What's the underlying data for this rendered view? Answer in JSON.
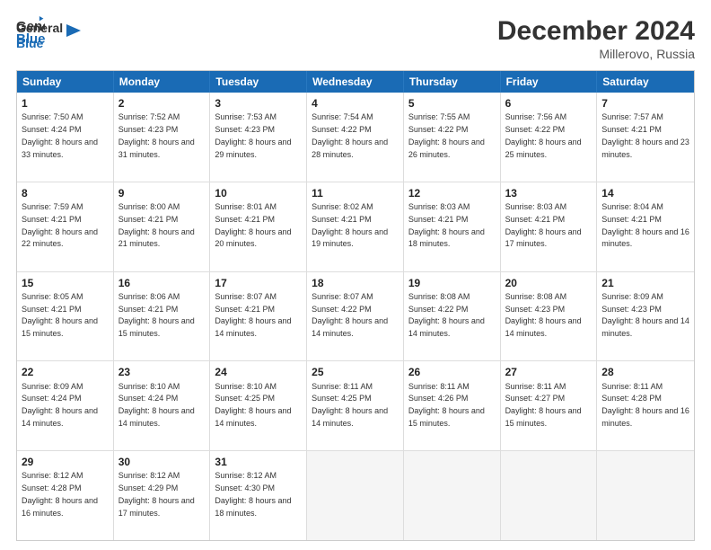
{
  "logo": {
    "line1": "General",
    "line2": "Blue"
  },
  "title": "December 2024",
  "subtitle": "Millerovo, Russia",
  "days": [
    "Sunday",
    "Monday",
    "Tuesday",
    "Wednesday",
    "Thursday",
    "Friday",
    "Saturday"
  ],
  "weeks": [
    [
      {
        "num": "1",
        "sunrise": "7:50 AM",
        "sunset": "4:24 PM",
        "daylight": "8 hours and 33 minutes."
      },
      {
        "num": "2",
        "sunrise": "7:52 AM",
        "sunset": "4:23 PM",
        "daylight": "8 hours and 31 minutes."
      },
      {
        "num": "3",
        "sunrise": "7:53 AM",
        "sunset": "4:23 PM",
        "daylight": "8 hours and 29 minutes."
      },
      {
        "num": "4",
        "sunrise": "7:54 AM",
        "sunset": "4:22 PM",
        "daylight": "8 hours and 28 minutes."
      },
      {
        "num": "5",
        "sunrise": "7:55 AM",
        "sunset": "4:22 PM",
        "daylight": "8 hours and 26 minutes."
      },
      {
        "num": "6",
        "sunrise": "7:56 AM",
        "sunset": "4:22 PM",
        "daylight": "8 hours and 25 minutes."
      },
      {
        "num": "7",
        "sunrise": "7:57 AM",
        "sunset": "4:21 PM",
        "daylight": "8 hours and 23 minutes."
      }
    ],
    [
      {
        "num": "8",
        "sunrise": "7:59 AM",
        "sunset": "4:21 PM",
        "daylight": "8 hours and 22 minutes."
      },
      {
        "num": "9",
        "sunrise": "8:00 AM",
        "sunset": "4:21 PM",
        "daylight": "8 hours and 21 minutes."
      },
      {
        "num": "10",
        "sunrise": "8:01 AM",
        "sunset": "4:21 PM",
        "daylight": "8 hours and 20 minutes."
      },
      {
        "num": "11",
        "sunrise": "8:02 AM",
        "sunset": "4:21 PM",
        "daylight": "8 hours and 19 minutes."
      },
      {
        "num": "12",
        "sunrise": "8:03 AM",
        "sunset": "4:21 PM",
        "daylight": "8 hours and 18 minutes."
      },
      {
        "num": "13",
        "sunrise": "8:03 AM",
        "sunset": "4:21 PM",
        "daylight": "8 hours and 17 minutes."
      },
      {
        "num": "14",
        "sunrise": "8:04 AM",
        "sunset": "4:21 PM",
        "daylight": "8 hours and 16 minutes."
      }
    ],
    [
      {
        "num": "15",
        "sunrise": "8:05 AM",
        "sunset": "4:21 PM",
        "daylight": "8 hours and 15 minutes."
      },
      {
        "num": "16",
        "sunrise": "8:06 AM",
        "sunset": "4:21 PM",
        "daylight": "8 hours and 15 minutes."
      },
      {
        "num": "17",
        "sunrise": "8:07 AM",
        "sunset": "4:21 PM",
        "daylight": "8 hours and 14 minutes."
      },
      {
        "num": "18",
        "sunrise": "8:07 AM",
        "sunset": "4:22 PM",
        "daylight": "8 hours and 14 minutes."
      },
      {
        "num": "19",
        "sunrise": "8:08 AM",
        "sunset": "4:22 PM",
        "daylight": "8 hours and 14 minutes."
      },
      {
        "num": "20",
        "sunrise": "8:08 AM",
        "sunset": "4:23 PM",
        "daylight": "8 hours and 14 minutes."
      },
      {
        "num": "21",
        "sunrise": "8:09 AM",
        "sunset": "4:23 PM",
        "daylight": "8 hours and 14 minutes."
      }
    ],
    [
      {
        "num": "22",
        "sunrise": "8:09 AM",
        "sunset": "4:24 PM",
        "daylight": "8 hours and 14 minutes."
      },
      {
        "num": "23",
        "sunrise": "8:10 AM",
        "sunset": "4:24 PM",
        "daylight": "8 hours and 14 minutes."
      },
      {
        "num": "24",
        "sunrise": "8:10 AM",
        "sunset": "4:25 PM",
        "daylight": "8 hours and 14 minutes."
      },
      {
        "num": "25",
        "sunrise": "8:11 AM",
        "sunset": "4:25 PM",
        "daylight": "8 hours and 14 minutes."
      },
      {
        "num": "26",
        "sunrise": "8:11 AM",
        "sunset": "4:26 PM",
        "daylight": "8 hours and 15 minutes."
      },
      {
        "num": "27",
        "sunrise": "8:11 AM",
        "sunset": "4:27 PM",
        "daylight": "8 hours and 15 minutes."
      },
      {
        "num": "28",
        "sunrise": "8:11 AM",
        "sunset": "4:28 PM",
        "daylight": "8 hours and 16 minutes."
      }
    ],
    [
      {
        "num": "29",
        "sunrise": "8:12 AM",
        "sunset": "4:28 PM",
        "daylight": "8 hours and 16 minutes."
      },
      {
        "num": "30",
        "sunrise": "8:12 AM",
        "sunset": "4:29 PM",
        "daylight": "8 hours and 17 minutes."
      },
      {
        "num": "31",
        "sunrise": "8:12 AM",
        "sunset": "4:30 PM",
        "daylight": "8 hours and 18 minutes."
      },
      null,
      null,
      null,
      null
    ]
  ],
  "labels": {
    "sunrise": "Sunrise:",
    "sunset": "Sunset:",
    "daylight": "Daylight:"
  }
}
